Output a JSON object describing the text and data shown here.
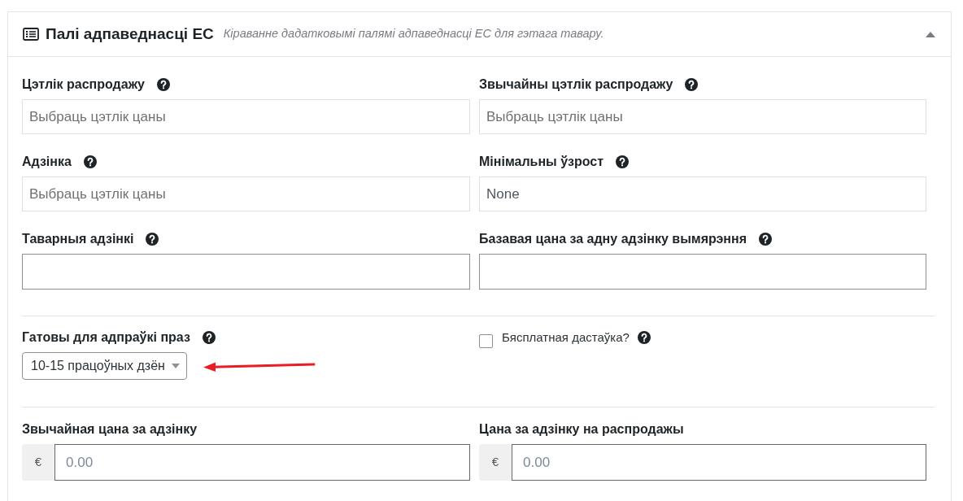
{
  "panel": {
    "title": "Палі адпаведнасці ЕС",
    "subtitle": "Кіраванне дадатковымі палямі адпаведнасці ЕС для гэтага тавару.",
    "expanded": true
  },
  "sections": [
    {
      "fields": [
        {
          "kind": "select",
          "label": "Цэтлік распродажу",
          "help": true,
          "placeholder": "Выбраць цэтлік цаны"
        },
        {
          "kind": "select",
          "label": "Звычайны цэтлік распродажу",
          "help": true,
          "placeholder": "Выбраць цэтлік цаны"
        },
        {
          "kind": "select",
          "label": "Адзінка",
          "help": true,
          "placeholder": "Выбраць цэтлік цаны"
        },
        {
          "kind": "select",
          "label": "Мінімальны ўзрост",
          "help": true,
          "value": "None"
        },
        {
          "kind": "text",
          "label": "Таварныя адзінкі",
          "help": true
        },
        {
          "kind": "text",
          "label": "Базавая цана за адну адзінку вымярэння",
          "help": true
        }
      ]
    },
    {
      "fields": [
        {
          "kind": "dropdown",
          "label": "Гатовы для адпраўкі праз",
          "help": true,
          "value": "10-15 працоўных дзён"
        },
        {
          "kind": "checkbox",
          "label": "Бясплатная дастаўка?",
          "help": true,
          "checked": false
        }
      ]
    },
    {
      "fields": [
        {
          "kind": "price",
          "label": "Звычайная цана за адзінку",
          "help": false,
          "prefix": "€",
          "placeholder": "0.00"
        },
        {
          "kind": "price",
          "label": "Цана за адзінку на распродажы",
          "help": false,
          "prefix": "€",
          "placeholder": "0.00"
        }
      ]
    }
  ]
}
